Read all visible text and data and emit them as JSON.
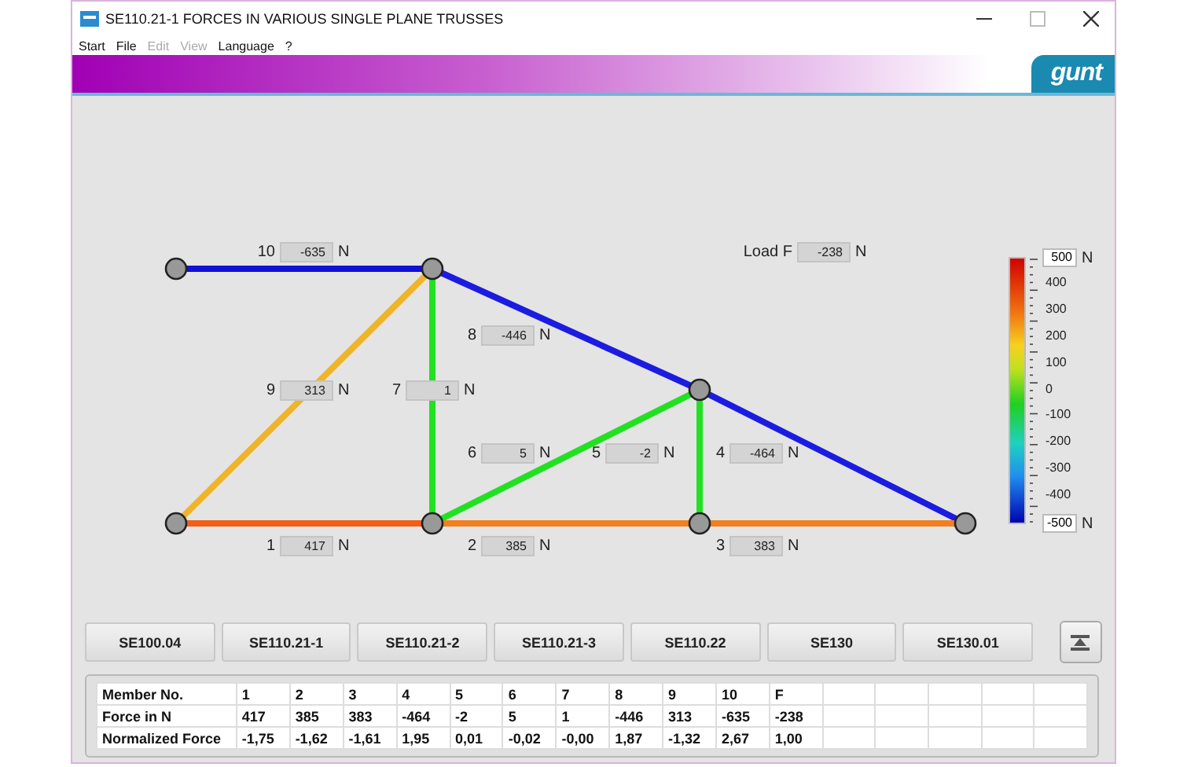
{
  "window": {
    "title": "SE110.21-1 FORCES IN VARIOUS SINGLE PLANE TRUSSES"
  },
  "menu": [
    {
      "label": "Start",
      "disabled": false
    },
    {
      "label": "File",
      "disabled": false
    },
    {
      "label": "Edit",
      "disabled": true
    },
    {
      "label": "View",
      "disabled": true
    },
    {
      "label": "Language",
      "disabled": false
    },
    {
      "label": "?",
      "disabled": false
    }
  ],
  "banner": {
    "logo": "gunt"
  },
  "members": [
    {
      "number": "10",
      "value": "-635",
      "unit": "N",
      "color": "#1010d8"
    },
    {
      "number": "8",
      "value": "-446",
      "unit": "N",
      "color": "#1c1ce0"
    },
    {
      "number": "9",
      "value": "313",
      "unit": "N",
      "color": "#f0b428"
    },
    {
      "number": "7",
      "value": "1",
      "unit": "N",
      "color": "#22e022"
    },
    {
      "number": "6",
      "value": "5",
      "unit": "N",
      "color": "#22e022"
    },
    {
      "number": "5",
      "value": "-2",
      "unit": "N",
      "color": "#22e022"
    },
    {
      "number": "4",
      "value": "-464",
      "unit": "N",
      "color": "#1c1ce0"
    },
    {
      "number": "1",
      "value": "417",
      "unit": "N",
      "color": "#f06018"
    },
    {
      "number": "2",
      "value": "385",
      "unit": "N",
      "color": "#f08020"
    },
    {
      "number": "3",
      "value": "383",
      "unit": "N",
      "color": "#f08020"
    }
  ],
  "load": {
    "label": "Load F",
    "value": "-238",
    "unit": "N"
  },
  "scale": {
    "max": "500",
    "min": "-500",
    "unit_top": "N",
    "unit_bottom": "N",
    "ticks": [
      "400",
      "300",
      "200",
      "100",
      "0",
      "-100",
      "-200",
      "-300",
      "-400"
    ]
  },
  "buttons": [
    "SE100.04",
    "SE110.21-1",
    "SE110.21-2",
    "SE110.21-3",
    "SE110.22",
    "SE130",
    "SE130.01"
  ],
  "table": {
    "rows": [
      [
        "Member No.",
        "1",
        "2",
        "3",
        "4",
        "5",
        "6",
        "7",
        "8",
        "9",
        "10",
        "F"
      ],
      [
        "Force in N",
        "417",
        "385",
        "383",
        "-464",
        "-2",
        "5",
        "1",
        "-446",
        "313",
        "-635",
        "-238"
      ],
      [
        "Normalized Force",
        "-1,75",
        "-1,62",
        "-1,61",
        "1,95",
        "0,01",
        "-0,02",
        "-0,00",
        "1,87",
        "-1,32",
        "2,67",
        "1,00"
      ]
    ]
  }
}
